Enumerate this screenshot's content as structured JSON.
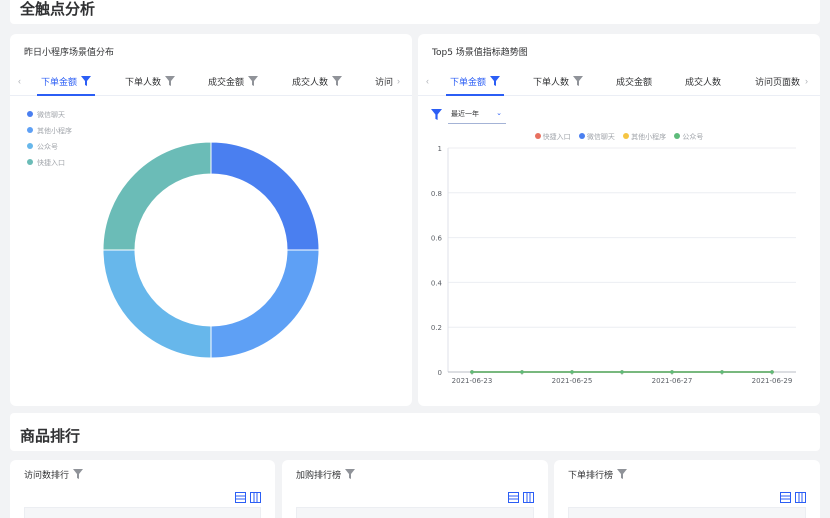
{
  "section1": {
    "title": "全触点分析"
  },
  "left_card": {
    "title": "昨日小程序场景值分布",
    "tabs": [
      "下单金额",
      "下单人数",
      "成交金额",
      "成交人数",
      "访问"
    ],
    "active_tab": 0,
    "legend": [
      {
        "name": "微信聊天",
        "color": "#4a7ff0"
      },
      {
        "name": "其他小程序",
        "color": "#5ea0f5"
      },
      {
        "name": "公众号",
        "color": "#67b7eb"
      },
      {
        "name": "快捷入口",
        "color": "#6bbcb7"
      }
    ]
  },
  "right_card": {
    "title": "Top5 场景值指标趋势图",
    "tabs": [
      "下单金额",
      "下单人数",
      "成交金额",
      "成交人数",
      "访问页面数"
    ],
    "active_tab": 0,
    "period_select": "最近一年",
    "legend": [
      {
        "name": "快捷入口",
        "color": "#e8705f"
      },
      {
        "name": "微信聊天",
        "color": "#4a7ff0"
      },
      {
        "name": "其他小程序",
        "color": "#f5c543"
      },
      {
        "name": "公众号",
        "color": "#5dbb7a"
      }
    ]
  },
  "chart_data": [
    {
      "type": "pie",
      "donut": true,
      "slices": [
        {
          "name": "微信聊天",
          "value": 25
        },
        {
          "name": "其他小程序",
          "value": 25
        },
        {
          "name": "公众号",
          "value": 25
        },
        {
          "name": "快捷入口",
          "value": 25
        }
      ],
      "legend_position": "top-left"
    },
    {
      "type": "line",
      "x": [
        "2021-06-23",
        "2021-06-24",
        "2021-06-25",
        "2021-06-26",
        "2021-06-27",
        "2021-06-28",
        "2021-06-29"
      ],
      "x_tick_labels": [
        "2021-06-23",
        "2021-06-25",
        "2021-06-27",
        "2021-06-29"
      ],
      "y_tick_labels": [
        "0",
        "0.2",
        "0.4",
        "0.6",
        "0.8",
        "1"
      ],
      "ylim": [
        0,
        1
      ],
      "grid": true,
      "legend_position": "top-center",
      "series": [
        {
          "name": "快捷入口",
          "values": [
            0,
            0,
            0,
            0,
            0,
            0,
            0
          ]
        },
        {
          "name": "微信聊天",
          "values": [
            0,
            0,
            0,
            0,
            0,
            0,
            0
          ]
        },
        {
          "name": "其他小程序",
          "values": [
            0,
            0,
            0,
            0,
            0,
            0,
            0
          ]
        },
        {
          "name": "公众号",
          "values": [
            0,
            0,
            0,
            0,
            0,
            0,
            0
          ]
        }
      ]
    }
  ],
  "section2": {
    "title": "商品排行"
  },
  "rank_cards": [
    {
      "title": "访问数排行"
    },
    {
      "title": "加购排行榜"
    },
    {
      "title": "下单排行榜"
    }
  ]
}
